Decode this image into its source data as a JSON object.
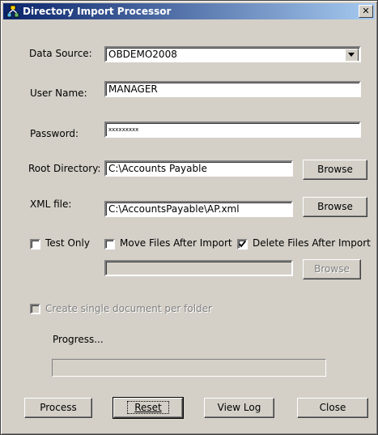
{
  "window": {
    "title": "Directory Import Processor",
    "close_glyph": "✕"
  },
  "form": {
    "data_source": {
      "label": "Data Source:",
      "value": "OBDEMO2008"
    },
    "user_name": {
      "label": "User Name:",
      "value": "MANAGER"
    },
    "password": {
      "label": "Password:",
      "value": "xxxxxxxxx"
    },
    "root_directory": {
      "label": "Root Directory:",
      "value": "C:\\Accounts Payable",
      "browse_label": "Browse"
    },
    "xml_file": {
      "label": "XML file:",
      "value": "C:\\AccountsPayable\\AP.xml",
      "browse_label": "Browse"
    },
    "options": {
      "test_only": {
        "label": "Test Only",
        "checked": false
      },
      "move_files": {
        "label": "Move Files After Import",
        "checked": false
      },
      "delete_files": {
        "label": "Delete Files After Import",
        "checked": true
      }
    },
    "move_destination": {
      "value": "",
      "browse_label": "Browse"
    },
    "single_document": {
      "label": "Create single document per folder",
      "checked": false
    },
    "progress": {
      "label": "Progress...",
      "value": 0
    }
  },
  "buttons": {
    "process": "Process",
    "reset": "Reset",
    "view_log": "View Log",
    "close": "Close"
  },
  "colors": {
    "face": "#d4d0c8",
    "title_start": "#0a246a",
    "title_end": "#a6caf0"
  },
  "icons": [
    "app-network-icon",
    "close-icon",
    "dropdown-arrow-icon",
    "checkmark-icon"
  ]
}
